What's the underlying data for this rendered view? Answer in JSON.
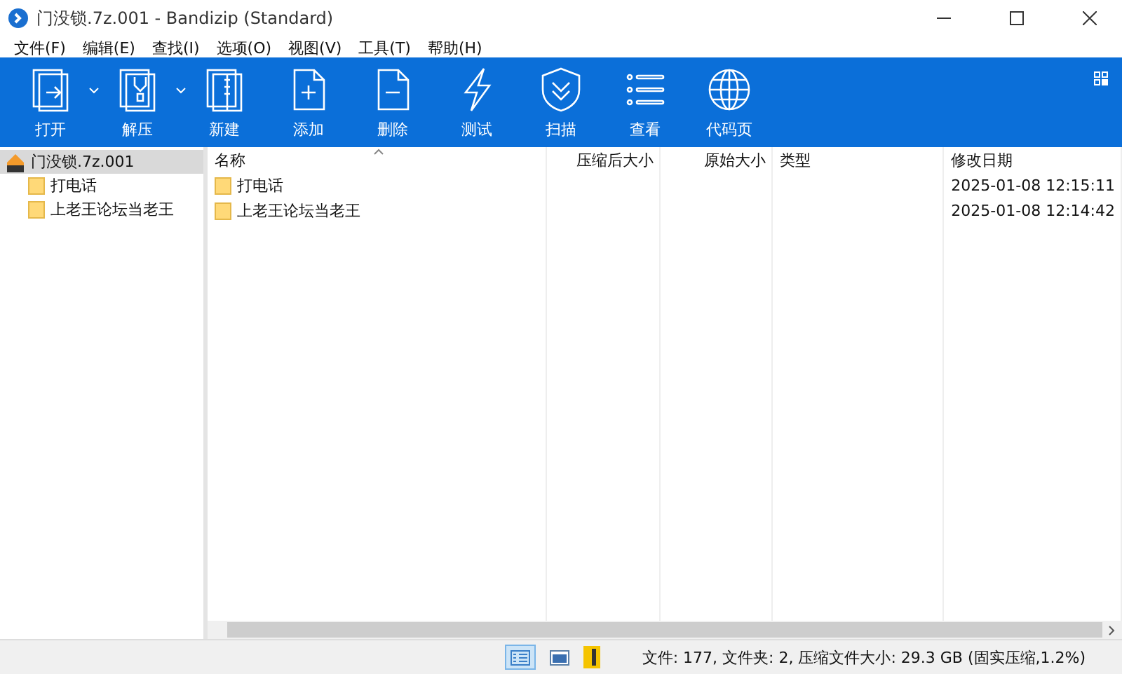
{
  "window": {
    "title": "门没锁.7z.001 - Bandizip (Standard)"
  },
  "menu": [
    "文件(F)",
    "编辑(E)",
    "查找(I)",
    "选项(O)",
    "视图(V)",
    "工具(T)",
    "帮助(H)"
  ],
  "toolbar": [
    {
      "kind": "open",
      "label": "打开",
      "dropdown": true
    },
    {
      "kind": "extract",
      "label": "解压",
      "dropdown": true
    },
    {
      "kind": "new",
      "label": "新建",
      "dropdown": false
    },
    {
      "kind": "add",
      "label": "添加",
      "dropdown": false
    },
    {
      "kind": "delete",
      "label": "删除",
      "dropdown": false
    },
    {
      "kind": "test",
      "label": "测试",
      "dropdown": false
    },
    {
      "kind": "scan",
      "label": "扫描",
      "dropdown": false
    },
    {
      "kind": "view",
      "label": "查看",
      "dropdown": false
    },
    {
      "kind": "codepage",
      "label": "代码页",
      "dropdown": false
    }
  ],
  "tree": {
    "label": "门没锁.7z.001",
    "selected": true,
    "children": [
      {
        "label": "打电话",
        "selected": false
      },
      {
        "label": "上老王论坛当老王",
        "selected": false
      }
    ]
  },
  "table": {
    "columns": [
      "名称",
      "压缩后大小",
      "原始大小",
      "类型",
      "修改日期"
    ],
    "rows": [
      {
        "name": "打电话",
        "modified": "2025-01-08 12:15:11"
      },
      {
        "name": "上老王论坛当老王",
        "modified": "2025-01-08 12:14:42"
      }
    ]
  },
  "status_bar": {
    "views": [
      {
        "kind": "details",
        "selected": true
      },
      {
        "kind": "preview",
        "selected": false
      }
    ],
    "text": "文件: 177, 文件夹: 2, 压缩文件大小: 29.3 GB (固实压缩,1.2%)"
  }
}
